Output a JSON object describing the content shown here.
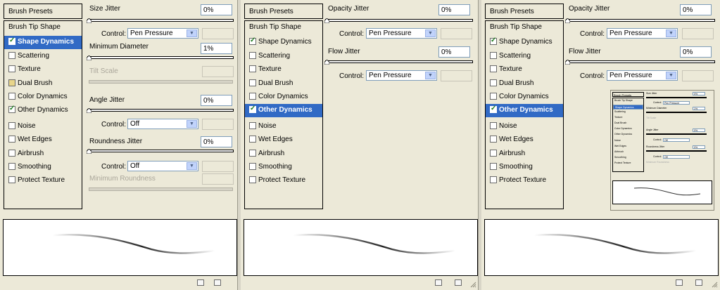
{
  "sidebar": {
    "presets_label": "Brush Presets",
    "tip_shape_label": "Brush Tip Shape",
    "options": [
      "Shape Dynamics",
      "Scattering",
      "Texture",
      "Dual Brush",
      "Color Dynamics",
      "Other Dynamics",
      "Noise",
      "Wet Edges",
      "Airbrush",
      "Smoothing",
      "Protect Texture"
    ]
  },
  "panel1": {
    "selected_option": "Shape Dynamics",
    "checked_options": [
      "Shape Dynamics",
      "Dual Brush",
      "Other Dynamics"
    ],
    "size_jitter": {
      "label": "Size Jitter",
      "value": "0%"
    },
    "size_control": {
      "label": "Control:",
      "value": "Pen Pressure"
    },
    "min_diameter": {
      "label": "Minimum Diameter",
      "value": "1%"
    },
    "tilt_scale": {
      "label": "Tilt Scale"
    },
    "angle_jitter": {
      "label": "Angle Jitter",
      "value": "0%"
    },
    "angle_control": {
      "label": "Control:",
      "value": "Off"
    },
    "roundness_jitter": {
      "label": "Roundness Jitter",
      "value": "0%"
    },
    "roundness_control": {
      "label": "Control:",
      "value": "Off"
    },
    "min_roundness": {
      "label": "Minimum Roundness"
    }
  },
  "panel2": {
    "selected_option": "Other Dynamics",
    "checked_options": [
      "Shape Dynamics",
      "Other Dynamics"
    ],
    "opacity_jitter": {
      "label": "Opacity Jitter",
      "value": "0%"
    },
    "opacity_control": {
      "label": "Control:",
      "value": "Pen Pressure"
    },
    "flow_jitter": {
      "label": "Flow Jitter",
      "value": "0%"
    },
    "flow_control": {
      "label": "Control:",
      "value": "Pen Pressure"
    }
  },
  "panel3": {
    "selected_option": "Other Dynamics",
    "checked_options": [
      "Shape Dynamics",
      "Other Dynamics"
    ],
    "opacity_jitter": {
      "label": "Opacity Jitter",
      "value": "0%"
    },
    "opacity_control": {
      "label": "Control:",
      "value": "Pen Pressure"
    },
    "flow_jitter": {
      "label": "Flow Jitter",
      "value": "0%"
    },
    "flow_control": {
      "label": "Control:",
      "value": "Pen Pressure"
    }
  },
  "thumbnail": {
    "presets_label": "Brush Presets",
    "tip_shape_label": "Brush Tip Shape",
    "options": [
      "Shape Dynamics",
      "Scattering",
      "Texture",
      "Dual Brush",
      "Color Dynamics",
      "Other Dynamics",
      "Noise",
      "Wet Edges",
      "Airbrush",
      "Smoothing",
      "Protect Texture"
    ],
    "size_jitter": "Size Jitter",
    "size_value": "0%",
    "control_label": "Control:",
    "control_value": "Pen Pressure",
    "min_diameter": "Minimum Diameter",
    "min_value": "1%",
    "tilt_scale": "Tilt Scale",
    "angle_jitter": "Angle Jitter",
    "angle_value": "0%",
    "angle_control": "Off",
    "roundness_jitter": "Roundness Jitter",
    "roundness_value": "0%",
    "roundness_control": "Off",
    "min_roundness": "Minimum Roundness"
  },
  "icons": {
    "new_preset": "new-preset-icon",
    "delete": "trash-icon",
    "resize": "resize-grip-icon",
    "dropdown": "chevron-down-icon"
  },
  "colors": {
    "panel_bg": "#ece9d8",
    "selection": "#316ac5",
    "check": "#1e7b1e"
  }
}
